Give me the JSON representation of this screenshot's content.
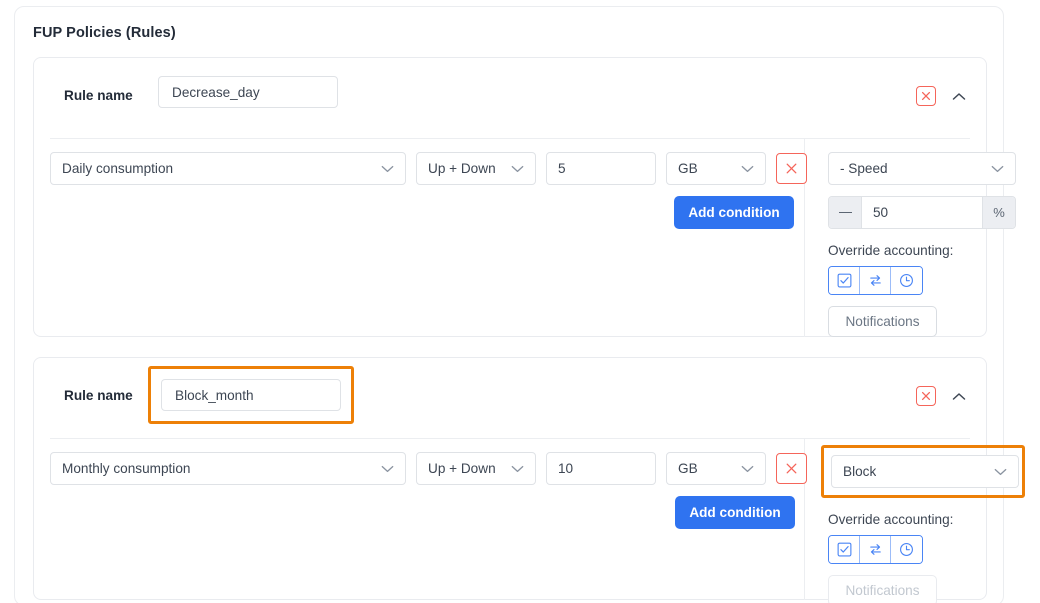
{
  "panel": {
    "title": "FUP Policies (Rules)"
  },
  "icons": {
    "delete_rule": "close-x-box-icon",
    "collapse": "chevron-up-icon",
    "delete_condition": "close-x-icon",
    "dropdown": "chevron-down-icon",
    "minus": "minus-icon",
    "override_checkbox": "checkbox-checked-icon",
    "override_swap": "swap-arrows-icon",
    "override_clock": "clock-icon"
  },
  "colors": {
    "accent_blue": "#2f73f0",
    "highlight_orange": "#ed8007",
    "danger_red": "#f5655a",
    "border_gray": "#dfe2e6",
    "text_dark": "#232b38",
    "text_body": "#3d4653",
    "text_muted": "#6b7684",
    "text_disabled": "#c2c8d0"
  },
  "labels": {
    "rule_name": "Rule name",
    "add_condition": "Add condition",
    "override_accounting": "Override accounting:",
    "notifications": "Notifications"
  },
  "rules": [
    {
      "name_value": "Decrease_day",
      "name_highlighted": false,
      "condition": {
        "metric": "Daily consumption",
        "direction": "Up + Down",
        "value": "5",
        "unit": "GB"
      },
      "action": {
        "type": "- Speed",
        "highlighted": false,
        "has_stepper": true,
        "stepper_value": "50",
        "stepper_suffix": "%"
      },
      "notifications_disabled": false
    },
    {
      "name_value": "Block_month",
      "name_highlighted": true,
      "condition": {
        "metric": "Monthly consumption",
        "direction": "Up + Down",
        "value": "10",
        "unit": "GB"
      },
      "action": {
        "type": "Block",
        "highlighted": true,
        "has_stepper": false,
        "stepper_value": "",
        "stepper_suffix": ""
      },
      "notifications_disabled": true
    }
  ]
}
